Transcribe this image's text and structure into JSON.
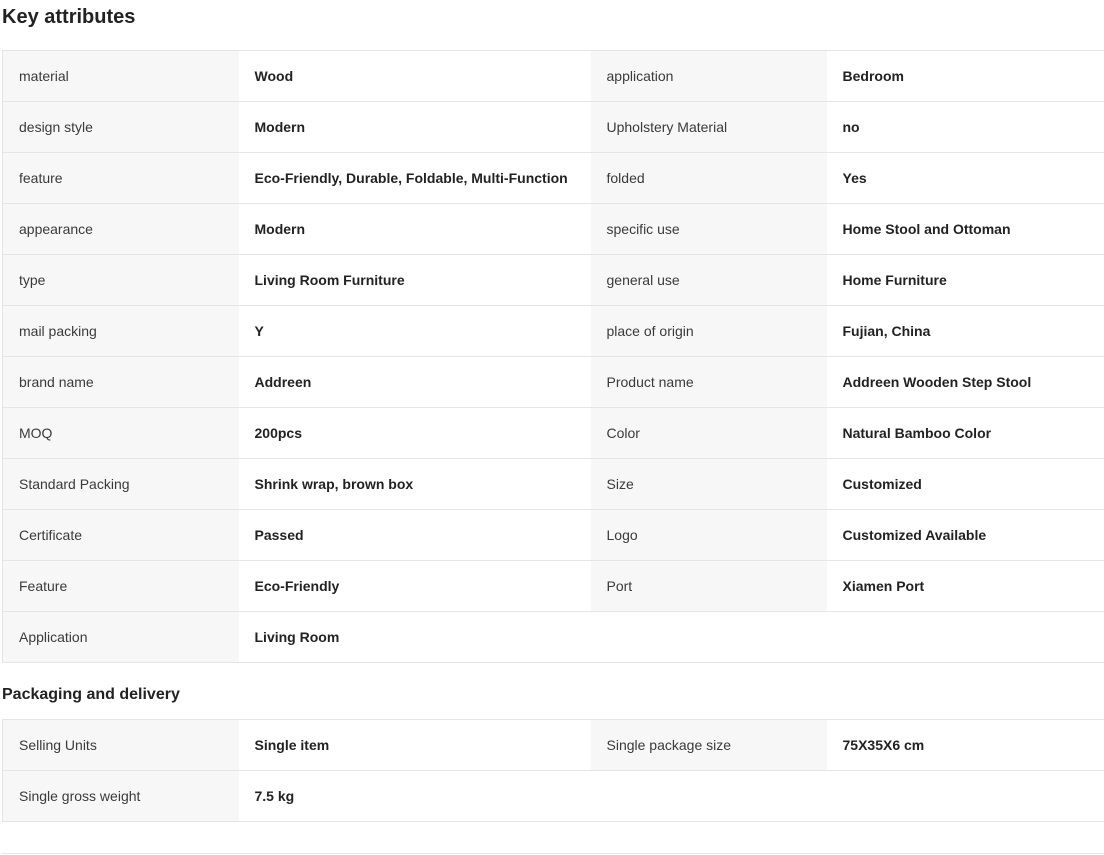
{
  "key_attributes": {
    "title": "Key attributes",
    "rows": [
      {
        "k1": "material",
        "v1": "Wood",
        "k2": "application",
        "v2": "Bedroom"
      },
      {
        "k1": "design style",
        "v1": "Modern",
        "k2": "Upholstery Material",
        "v2": "no"
      },
      {
        "k1": "feature",
        "v1": "Eco-Friendly, Durable, Foldable, Multi-Function",
        "k2": "folded",
        "v2": "Yes"
      },
      {
        "k1": "appearance",
        "v1": "Modern",
        "k2": "specific use",
        "v2": "Home Stool and Ottoman"
      },
      {
        "k1": "type",
        "v1": "Living Room Furniture",
        "k2": "general use",
        "v2": "Home Furniture"
      },
      {
        "k1": "mail packing",
        "v1": "Y",
        "k2": "place of origin",
        "v2": "Fujian, China"
      },
      {
        "k1": "brand name",
        "v1": "Addreen",
        "k2": "Product name",
        "v2": "Addreen Wooden Step Stool"
      },
      {
        "k1": "MOQ",
        "v1": "200pcs",
        "k2": "Color",
        "v2": "Natural Bamboo Color"
      },
      {
        "k1": "Standard Packing",
        "v1": "Shrink wrap, brown box",
        "k2": "Size",
        "v2": "Customized"
      },
      {
        "k1": "Certificate",
        "v1": "Passed",
        "k2": "Logo",
        "v2": "Customized Available"
      },
      {
        "k1": "Feature",
        "v1": "Eco-Friendly",
        "k2": "Port",
        "v2": "Xiamen Port"
      },
      {
        "k1": "Application",
        "v1": "Living Room"
      }
    ]
  },
  "packaging_delivery": {
    "title": "Packaging and delivery",
    "rows": [
      {
        "k1": "Selling Units",
        "v1": "Single item",
        "k2": "Single package size",
        "v2": "75X35X6 cm"
      },
      {
        "k1": "Single gross weight",
        "v1": "7.5 kg"
      }
    ]
  },
  "colors": {
    "label_cell_bg": "#f7f7f7",
    "value_cell_bg": "#ffffff",
    "border": "#e5e5e5",
    "text": "#222222"
  }
}
